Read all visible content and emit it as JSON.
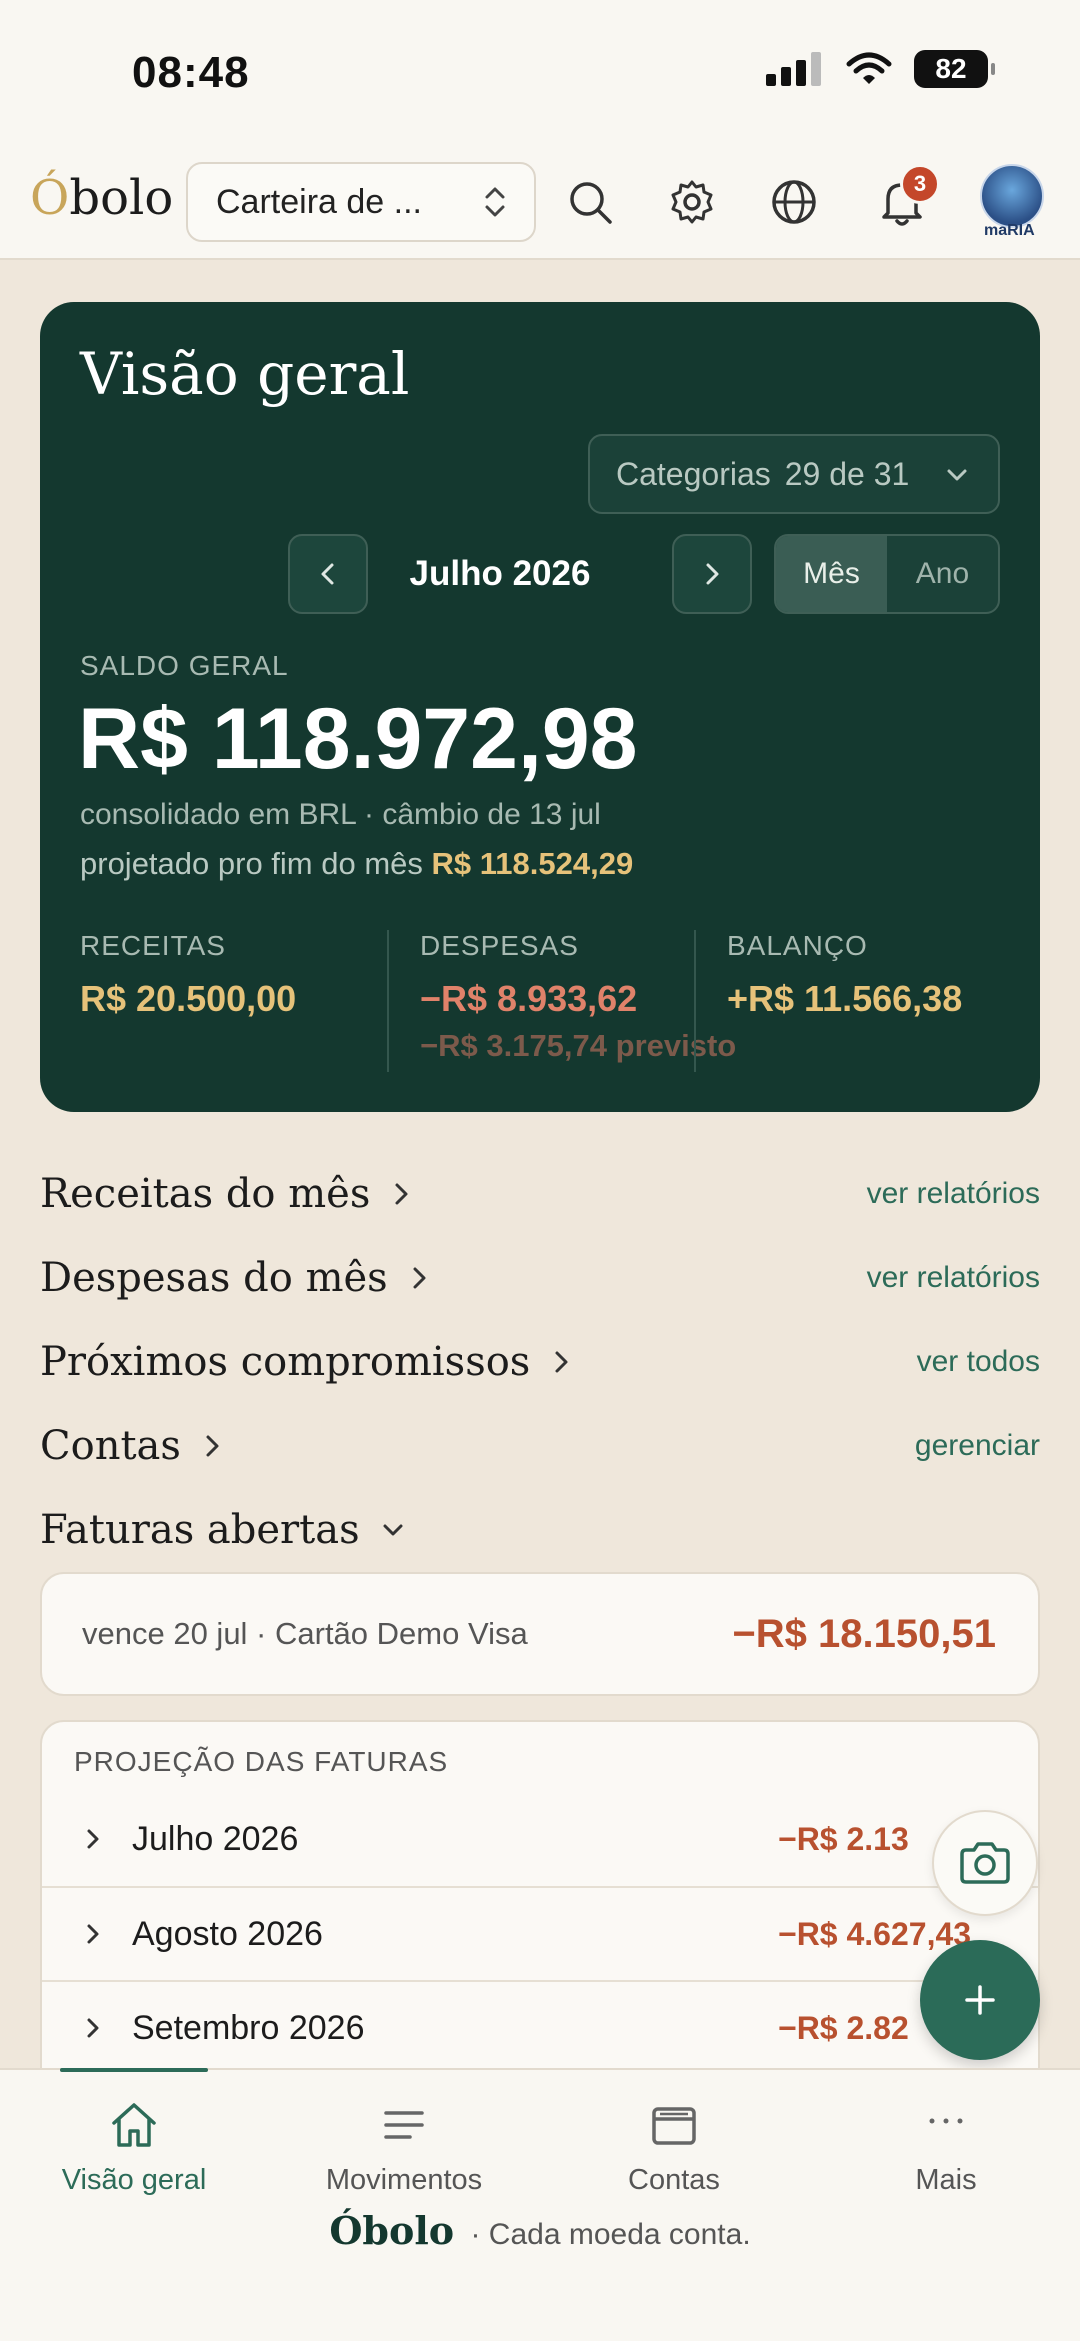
{
  "status_bar": {
    "time": "08:48",
    "battery": "82"
  },
  "header": {
    "logo_first": "Ó",
    "logo_rest": "bolo",
    "wallet_label": "Carteira de ...",
    "notifications_count": "3",
    "avatar_label": "maRIA"
  },
  "overview": {
    "title": "Visão geral",
    "categories_label": "Categorias",
    "categories_count": "29 de 31",
    "month": "Julho 2026",
    "seg_month": "Mês",
    "seg_year": "Ano",
    "saldo_label": "SALDO GERAL",
    "saldo_value": "R$ 118.972,98",
    "consolidated": "consolidado em BRL · câmbio de 13 jul",
    "projected_prefix": "projetado pro fim do mês",
    "projected_value": "R$ 118.524,29",
    "receitas_label": "RECEITAS",
    "receitas_value": "R$ 20.500,00",
    "despesas_label": "DESPESAS",
    "despesas_value": "−R$ 8.933,62",
    "despesas_previsto": "−R$ 3.175,74 previsto",
    "balanco_label": "BALANÇO",
    "balanco_value": "+R$ 11.566,38"
  },
  "sections": {
    "receitas": {
      "title": "Receitas do mês",
      "link": "ver relatórios"
    },
    "despesas": {
      "title": "Despesas do mês",
      "link": "ver relatórios"
    },
    "compromissos": {
      "title": "Próximos compromissos",
      "link": "ver todos"
    },
    "contas": {
      "title": "Contas",
      "link": "gerenciar"
    },
    "faturas": {
      "title": "Faturas abertas"
    }
  },
  "fatura": {
    "description": "vence 20 jul · Cartão Demo Visa",
    "amount": "−R$ 18.150,51"
  },
  "projection": {
    "label": "PROJEÇÃO DAS FATURAS",
    "rows": [
      {
        "month": "Julho 2026",
        "value": "−R$ 2.13"
      },
      {
        "month": "Agosto 2026",
        "value": "−R$ 4.627,43"
      },
      {
        "month": "Setembro 2026",
        "value": "−R$ 2.82"
      }
    ]
  },
  "bottom_nav": {
    "tabs": [
      {
        "label": "Visão geral",
        "icon": "home-icon"
      },
      {
        "label": "Movimentos",
        "icon": "list-icon"
      },
      {
        "label": "Contas",
        "icon": "wallet-icon"
      },
      {
        "label": "Mais",
        "icon": "more-icon"
      }
    ]
  },
  "footer": {
    "brand": "Óbolo",
    "tagline": "· Cada moeda conta."
  },
  "colors": {
    "card_bg": "#14382f",
    "accent_green": "#2c6b58",
    "expense_red": "#b8512f",
    "income_gold": "#e6c27a"
  }
}
